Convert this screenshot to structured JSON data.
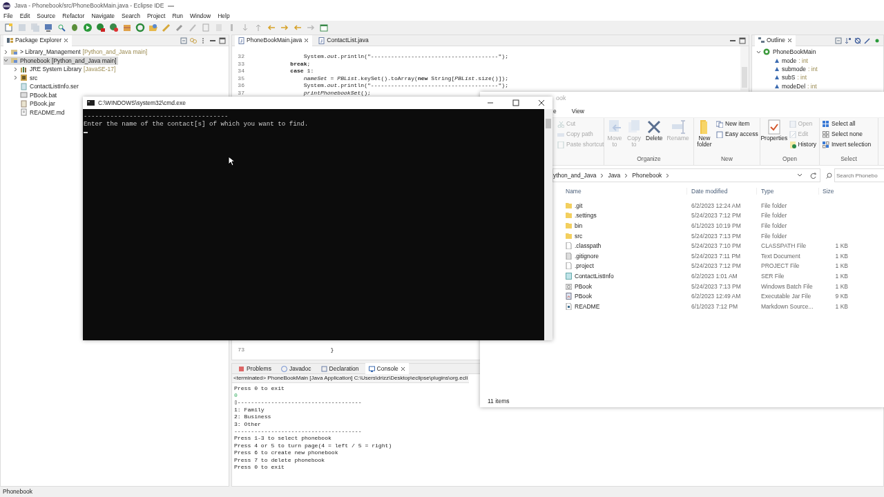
{
  "eclipse": {
    "title": "Java - Phonebook/src/PhoneBookMain.java - Eclipse IDE",
    "menu": [
      "File",
      "Edit",
      "Source",
      "Refactor",
      "Navigate",
      "Search",
      "Project",
      "Run",
      "Window",
      "Help"
    ],
    "package_explorer": {
      "title": "Package Explorer",
      "items": [
        {
          "kind": "project",
          "label": "> Library_Management",
          "decoration": "[Python_and_Java main]",
          "expanded": false,
          "selected": false
        },
        {
          "kind": "project",
          "label": "Phonebook",
          "decoration": "[Python_and_Java main]",
          "expanded": true,
          "selected": true,
          "children": [
            {
              "kind": "library",
              "label": "JRE System Library",
              "decoration": "[JavaSE-17]",
              "expanded": false,
              "selected": false
            },
            {
              "kind": "package",
              "label": "src",
              "expanded": false,
              "selected": false
            },
            {
              "kind": "ser",
              "label": "ContactListInfo.ser",
              "selected": false
            },
            {
              "kind": "bat",
              "label": "PBook.bat",
              "selected": false
            },
            {
              "kind": "jar",
              "label": "PBook.jar",
              "selected": false
            },
            {
              "kind": "md",
              "label": "README.md",
              "selected": false
            }
          ]
        }
      ]
    },
    "editor": {
      "tabs": [
        {
          "label": "PhoneBookMain.java",
          "selected": true
        },
        {
          "label": "ContactList.java",
          "selected": false
        }
      ],
      "lines_top": [
        {
          "number": "32",
          "code": "                System.*out*.println(\"--------------------------------------\");"
        },
        {
          "number": "33",
          "code": "            **break**;"
        },
        {
          "number": "34",
          "code": "            **case** 1:"
        },
        {
          "number": "35",
          "code": "                *nameSet* = *PBList*.keySet().toArray(**new** String[*PBList*.size()]);"
        },
        {
          "number": "36",
          "code": "                System.*out*.println(\"--------------------------------------\");"
        },
        {
          "number": "37",
          "code": "                *printPhonebookSet*();"
        }
      ],
      "lines_bottom": [
        {
          "number": "73",
          "code": "                        }"
        }
      ]
    },
    "outline": {
      "title": "Outline",
      "class_name": "PhoneBookMain",
      "fields": [
        {
          "name": "mode",
          "type": ": int"
        },
        {
          "name": "submode",
          "type": ": int"
        },
        {
          "name": "subS",
          "type": ": int"
        },
        {
          "name": "modeDel",
          "type": ": int"
        }
      ]
    },
    "console_view": {
      "tabs": [
        {
          "label": "Problems",
          "selected": false
        },
        {
          "label": "Javadoc",
          "selected": false
        },
        {
          "label": "Declaration",
          "selected": false
        },
        {
          "label": "Console",
          "selected": true
        }
      ],
      "header": "<terminated> PhoneBookMain [Java Application] C:\\Users\\drizz\\Desktop\\eclipse\\plugins\\org.ecli",
      "lines": [
        {
          "text": "Press 0 to exit",
          "kind": "output"
        },
        {
          "text": "0",
          "kind": "input"
        },
        {
          "text": "▯-------------------------------------",
          "kind": "output"
        },
        {
          "text": "1: Family",
          "kind": "output"
        },
        {
          "text": "2: Business",
          "kind": "output"
        },
        {
          "text": "3: Other",
          "kind": "output"
        },
        {
          "text": "--------------------------------------",
          "kind": "output"
        },
        {
          "text": "Press 1-3 to select phonebook",
          "kind": "output"
        },
        {
          "text": "Press 4 or 5 to turn page(4 = left / 5 = right)",
          "kind": "output"
        },
        {
          "text": "Press 6 to create new phonebook",
          "kind": "output"
        },
        {
          "text": "Press 7 to delete phonebook",
          "kind": "output"
        },
        {
          "text": "Press 0 to exit",
          "kind": "output"
        }
      ]
    },
    "status_bar": "Phonebook"
  },
  "explorer": {
    "title": "ook",
    "ribbon_tabs": [
      {
        "label": "e",
        "selected": false
      },
      {
        "label": "View",
        "selected": false
      }
    ],
    "ribbon_groups": [
      {
        "items": [
          {
            "label": "Cut",
            "kind": "small",
            "disabled": true
          },
          {
            "label": "Copy path",
            "kind": "small",
            "disabled": true
          },
          {
            "label": "Paste shortcut",
            "kind": "small",
            "disabled": true
          }
        ]
      },
      {
        "label": "Organize",
        "items": [
          {
            "label": "Move to",
            "kind": "large",
            "disabled": true
          },
          {
            "label": "Copy to",
            "kind": "large",
            "disabled": true
          },
          {
            "label": "Delete",
            "kind": "large",
            "disabled": false
          },
          {
            "label": "Rename",
            "kind": "large",
            "disabled": true
          }
        ]
      },
      {
        "label": "New",
        "items": [
          {
            "label": "New folder",
            "kind": "large",
            "disabled": false
          },
          {
            "label": "New item",
            "kind": "small",
            "disabled": false
          },
          {
            "label": "Easy access",
            "kind": "small",
            "disabled": false
          }
        ]
      },
      {
        "label": "Open",
        "items": [
          {
            "label": "Properties",
            "kind": "large",
            "disabled": false
          },
          {
            "label": "Open",
            "kind": "small",
            "disabled": true
          },
          {
            "label": "Edit",
            "kind": "small",
            "disabled": true
          },
          {
            "label": "History",
            "kind": "small",
            "disabled": false
          }
        ]
      },
      {
        "label": "Select",
        "items": [
          {
            "label": "Select all",
            "kind": "small",
            "disabled": false
          },
          {
            "label": "Select none",
            "kind": "small",
            "disabled": false
          },
          {
            "label": "Invert selection",
            "kind": "small",
            "disabled": false
          }
        ]
      }
    ],
    "address": [
      "ython_and_Java",
      "Java",
      "Phonebook"
    ],
    "search_placeholder": "Search Phonebo",
    "columns": [
      "Name",
      "Date modified",
      "Type",
      "Size"
    ],
    "rows": [
      {
        "name": ".git",
        "date": "6/2/2023 12:24 AM",
        "type": "File folder",
        "kind": "folder"
      },
      {
        "name": ".settings",
        "date": "5/24/2023 7:12 PM",
        "type": "File folder",
        "kind": "folder"
      },
      {
        "name": "bin",
        "date": "6/1/2023 10:19 PM",
        "type": "File folder",
        "kind": "folder"
      },
      {
        "name": "src",
        "date": "5/24/2023 7:13 PM",
        "type": "File folder",
        "kind": "folder"
      },
      {
        "name": ".classpath",
        "date": "5/24/2023 7:10 PM",
        "type": "CLASSPATH File",
        "size": "1 KB",
        "kind": "file"
      },
      {
        "name": ".gitignore",
        "date": "5/24/2023 7:11 PM",
        "type": "Text Document",
        "size": "1 KB",
        "kind": "text"
      },
      {
        "name": ".project",
        "date": "5/24/2023 7:12 PM",
        "type": "PROJECT File",
        "size": "1 KB",
        "kind": "file"
      },
      {
        "name": "ContactListInfo",
        "date": "6/2/2023 1:01 AM",
        "type": "SER File",
        "size": "1 KB",
        "kind": "ser"
      },
      {
        "name": "PBook",
        "date": "5/24/2023 7:13 PM",
        "type": "Windows Batch File",
        "size": "1 KB",
        "kind": "bat"
      },
      {
        "name": "PBook",
        "date": "6/2/2023 12:49 AM",
        "type": "Executable Jar File",
        "size": "9 KB",
        "kind": "jar"
      },
      {
        "name": "README",
        "date": "6/1/2023 7:12 PM",
        "type": "Markdown Source...",
        "size": "1 KB",
        "kind": "md"
      }
    ],
    "status": "11 items"
  },
  "cmd": {
    "title": "C:\\WINDOWS\\system32\\cmd.exe",
    "lines": [
      "--------------------------------------",
      "Enter the name of the contact[s] of which you want to find."
    ]
  }
}
